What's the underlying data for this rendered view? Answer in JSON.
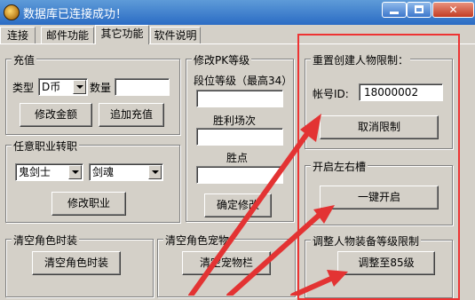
{
  "window": {
    "title": "数据库已连接成功！"
  },
  "tabs": [
    {
      "label": "连接"
    },
    {
      "label": "邮件功能"
    },
    {
      "label": "其它功能"
    },
    {
      "label": "软件说明"
    }
  ],
  "recharge": {
    "title": "充值",
    "type_label": "类型",
    "type_value": "D币",
    "qty_label": "数量",
    "qty_value": "",
    "modify_btn": "修改金额",
    "add_btn": "追加充值"
  },
  "pk": {
    "title": "修改PK等级",
    "rank_label": "段位等级（最高34）",
    "rank_value": "",
    "wins_label": "胜利场次",
    "wins_value": "",
    "points_label": "胜点",
    "points_value": "",
    "confirm_btn": "确定修改"
  },
  "job": {
    "title": "任意职业转职",
    "class_value": "鬼剑士",
    "sub_value": "剑魂",
    "modify_btn": "修改职业"
  },
  "clear_char": {
    "title": "清空角色时装",
    "btn": "清空角色时装"
  },
  "clear_pet": {
    "title": "清空角色宠物",
    "btn": "清空宠物栏"
  },
  "reset_limit": {
    "title": "重置创建人物限制：",
    "account_label": "帐号ID:",
    "account_value": "18000002",
    "cancel_btn": "取消限制"
  },
  "slots": {
    "title": "开启左右槽",
    "btn": "一键开启"
  },
  "equip": {
    "title": "调整人物装备等级限制",
    "btn": "调整至85级"
  },
  "colors": {
    "title_bar": "#2b6cc4",
    "annotation": "#e33333"
  }
}
